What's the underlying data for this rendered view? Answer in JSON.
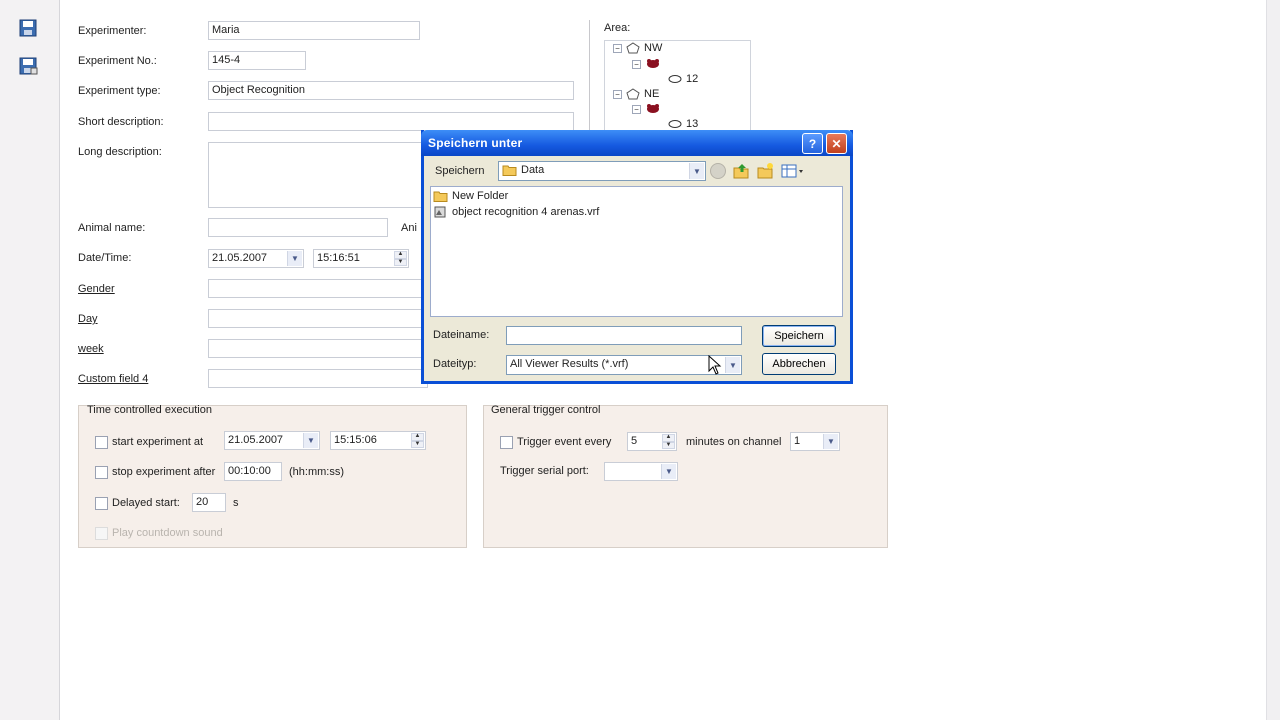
{
  "toolbar": {
    "icons": [
      "save-icon",
      "save-as-icon"
    ]
  },
  "form": {
    "experimenter": {
      "label": "Experimenter:",
      "value": "Maria"
    },
    "experiment_no": {
      "label": "Experiment No.:",
      "value": "145-4"
    },
    "experiment_type": {
      "label": "Experiment type:",
      "value": "Object Recognition"
    },
    "short_description": {
      "label": "Short description:",
      "value": ""
    },
    "long_description": {
      "label": "Long description:",
      "value": ""
    },
    "animal_name": {
      "label": "Animal name:",
      "value": ""
    },
    "animal_partial_label": "Ani",
    "datetime": {
      "label": "Date/Time:",
      "date": "21.05.2007",
      "time": "15:16:51"
    },
    "gender": {
      "label": "Gender",
      "value": ""
    },
    "day": {
      "label": "Day",
      "value": ""
    },
    "week": {
      "label": "week",
      "value": ""
    },
    "custom_field_4": {
      "label": "Custom field 4",
      "value": ""
    }
  },
  "area": {
    "label": "Area:",
    "items": [
      {
        "name": "NW",
        "child": "12"
      },
      {
        "name": "NE",
        "child": "13"
      }
    ]
  },
  "time_control": {
    "title": "Time controlled execution",
    "start_label": "start experiment at",
    "start_date": "21.05.2007",
    "start_time": "15:15:06",
    "stop_label": "stop experiment after",
    "stop_value": "00:10:00",
    "stop_format": "(hh:mm:ss)",
    "delayed_label": "Delayed start:",
    "delayed_value": "20",
    "delayed_unit": "s",
    "countdown_label": "Play countdown sound"
  },
  "trigger": {
    "title": "General trigger control",
    "event_label": "Trigger event every",
    "event_value": "5",
    "minutes_label": "minutes on channel",
    "channel_value": "1",
    "serial_label": "Trigger serial port:",
    "serial_value": ""
  },
  "dialog": {
    "title": "Speichern unter",
    "save_in_label": "Speichern",
    "folder": "Data",
    "files": [
      "New Folder",
      "object recognition 4 arenas.vrf"
    ],
    "filename_label": "Dateiname:",
    "filename_value": "",
    "filetype_label": "Dateityp:",
    "filetype_value": "All Viewer Results (*.vrf)",
    "save_button": "Speichern",
    "cancel_button": "Abbrechen",
    "help_button": "?",
    "close_button": "✕"
  },
  "colors": {
    "dialog_titlebar": "#1559e0",
    "group_bg": "#f6efea"
  }
}
